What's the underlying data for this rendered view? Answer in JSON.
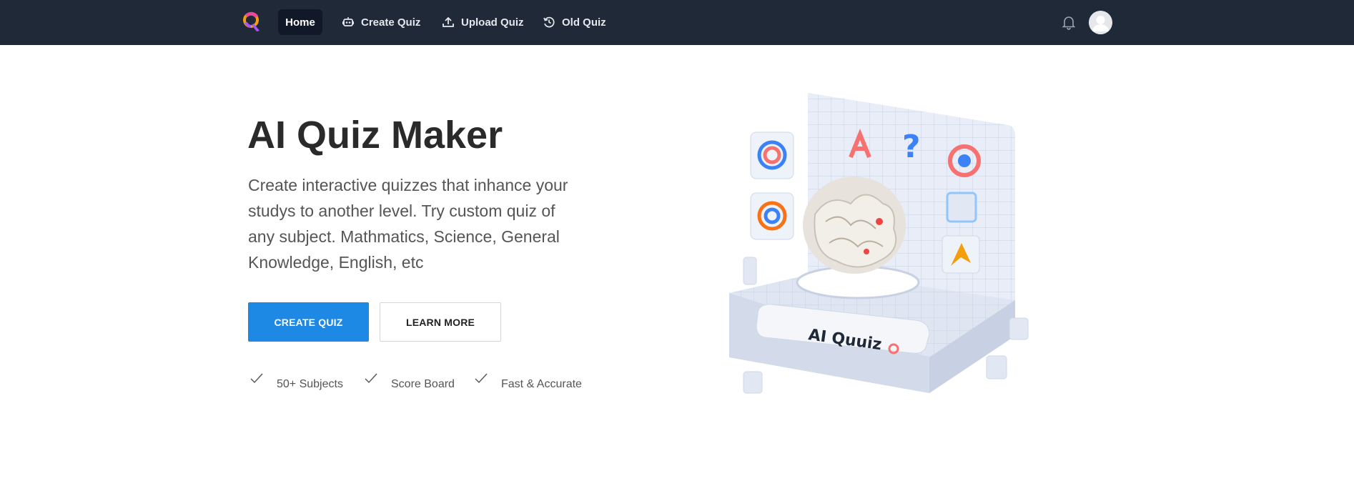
{
  "nav": {
    "items": [
      {
        "label": "Home",
        "icon": "home",
        "active": true
      },
      {
        "label": "Create Quiz",
        "icon": "robot-icon"
      },
      {
        "label": "Upload Quiz",
        "icon": "upload-icon"
      },
      {
        "label": "Old Quiz",
        "icon": "history-icon"
      }
    ],
    "bell_icon": "bell-icon",
    "avatar_icon": "user-avatar"
  },
  "hero": {
    "title": "AI Quiz Maker",
    "description": "Create interactive quizzes that inhance your studys to another level. Try custom quiz of any subject. Mathmatics, Science, General Knowledge, English, etc",
    "primary_button": "CREATE QUIZ",
    "secondary_button": "LEARN MORE",
    "features": [
      "50+ Subjects",
      "Score Board",
      "Fast & Accurate"
    ],
    "illustration_label": "AI Quuiz"
  },
  "colors": {
    "navbar": "#1f2937",
    "primary": "#1e88e5",
    "title": "#2a2a2a"
  }
}
